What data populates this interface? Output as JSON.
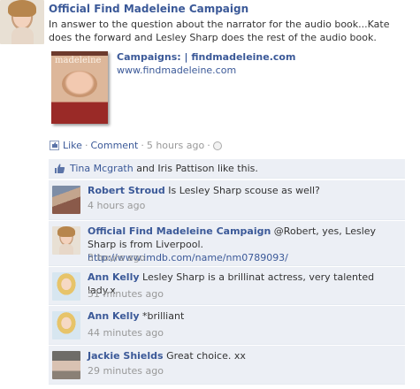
{
  "post": {
    "author": "Official Find Madeleine Campaign",
    "text": "In answer to the question about the narrator for the audio book...Kate does the forward and Lesley Sharp does the rest of the audio book."
  },
  "attachment": {
    "book_cover_title": "madeleine",
    "title": "Campaigns: | findmadeleine.com",
    "url": "www.findmadeleine.com"
  },
  "actions": {
    "like": "Like",
    "comment": "Comment",
    "time": "5 hours ago",
    "dot": "·"
  },
  "likes": {
    "user1": "Tina Mcgrath",
    "rest": " and Iris Pattison like this."
  },
  "comments": [
    {
      "name": "Robert Stroud",
      "text": " Is Lesley Sharp scouse as well?",
      "time": "4 hours ago"
    },
    {
      "name": "Official Find Madeleine Campaign",
      "text": " @Robert, yes, Lesley Sharp is from Liverpool. ",
      "link": "http://www.imdb.com/name/nm0789093/",
      "time": "3 hours ago"
    },
    {
      "name": "Ann Kelly",
      "text": " Lesley Sharp is a brillinat actress, very talented lady.x",
      "time": "51 minutes ago"
    },
    {
      "name": "Ann Kelly",
      "text": " *brilliant",
      "time": "44 minutes ago"
    },
    {
      "name": "Jackie Shields",
      "text": " Great choice. xx",
      "time": "29 minutes ago"
    }
  ],
  "colors": {
    "link": "#3b5998",
    "comment_bg": "#eceff5",
    "muted": "#999999"
  }
}
